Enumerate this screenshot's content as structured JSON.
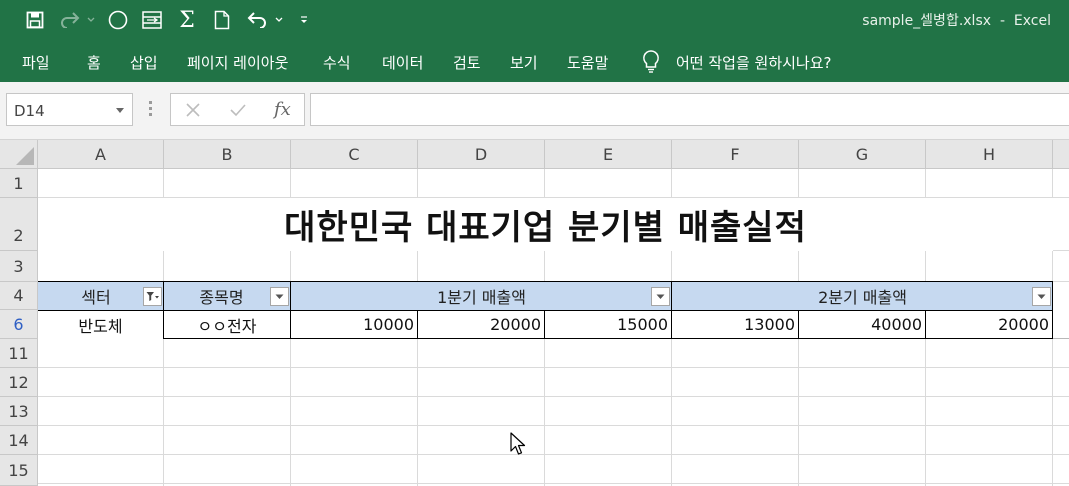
{
  "titlebar": {
    "filename": "sample_셀병합.xlsx",
    "separator": "-",
    "app": "Excel"
  },
  "ribbon": {
    "tabs": [
      "파일",
      "홈",
      "삽입",
      "페이지 레이아웃",
      "수식",
      "데이터",
      "검토",
      "보기",
      "도움말"
    ],
    "tell_me": "어떤 작업을 원하시나요?"
  },
  "formula_bar": {
    "name_box": "D14",
    "fx_label": "fx",
    "formula": ""
  },
  "columns": [
    "A",
    "B",
    "C",
    "D",
    "E",
    "F",
    "G",
    "H"
  ],
  "rows": [
    "1",
    "2",
    "3",
    "4",
    "6",
    "11",
    "12",
    "13",
    "14",
    "15"
  ],
  "sheet": {
    "title": "대한민국 대표기업 분기별 매출실적",
    "headers": {
      "sector": "섹터",
      "company": "종목명",
      "q1": "1분기 매출액",
      "q2": "2분기 매출액"
    },
    "data_row": {
      "sector": "반도체",
      "company": "ㅇㅇ전자",
      "values": [
        "10000",
        "20000",
        "15000",
        "13000",
        "40000",
        "20000"
      ]
    }
  },
  "colors": {
    "excel_green": "#217346",
    "header_fill": "#c6d9f0",
    "filtered_row_number": "#2f5fc4"
  },
  "icons": [
    "save-icon",
    "redo-icon",
    "circle-icon",
    "text-column-icon",
    "autosum-icon",
    "new-file-icon",
    "undo-icon",
    "customize-qat-icon",
    "lightbulb-icon",
    "cancel-icon",
    "enter-icon",
    "filter-active-icon",
    "filter-dropdown-icon"
  ]
}
